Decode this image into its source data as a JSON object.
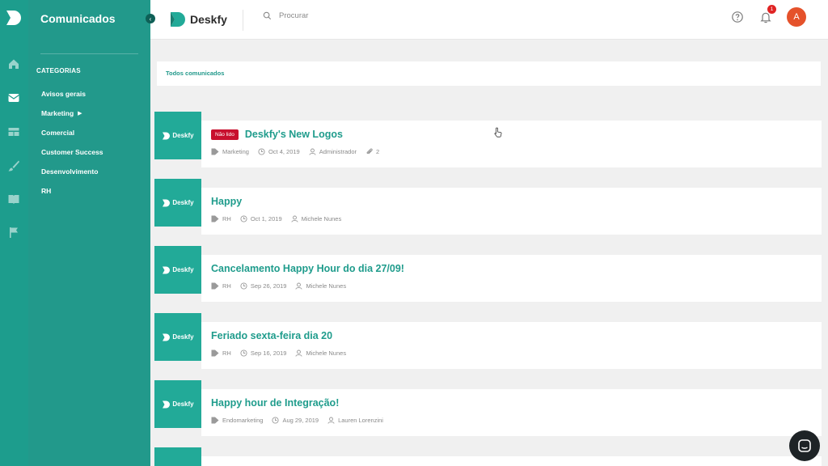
{
  "sidebar": {
    "title": "Comunicados",
    "heading": "CATEGORIAS",
    "items": [
      {
        "label": "Avisos gerais"
      },
      {
        "label": "Marketing",
        "has_submenu": true
      },
      {
        "label": "Comercial"
      },
      {
        "label": "Customer Success"
      },
      {
        "label": "Desenvolvimento"
      },
      {
        "label": "RH"
      }
    ]
  },
  "rail": {
    "icons": [
      "home-icon",
      "mail-icon",
      "layout-icon",
      "brush-icon",
      "book-icon",
      "flag-icon"
    ]
  },
  "header": {
    "brand": "Deskfy",
    "search_placeholder": "Procurar",
    "notification_count": "1",
    "avatar_initial": "A"
  },
  "filter": {
    "label": "Todos comunicados"
  },
  "thumb_label": "Deskfy",
  "announcements": [
    {
      "badge": "Não lido",
      "title": "Deskfy's New Logos",
      "category": "Marketing",
      "date": "Oct 4, 2019",
      "author": "Administrador",
      "attachments": "2"
    },
    {
      "title": "Happy",
      "category": "RH",
      "date": "Oct 1, 2019",
      "author": "Michele Nunes"
    },
    {
      "title": "Cancelamento Happy Hour do dia 27/09!",
      "category": "RH",
      "date": "Sep 26, 2019",
      "author": "Michele Nunes"
    },
    {
      "title": "Feriado sexta-feira dia 20",
      "category": "RH",
      "date": "Sep 16, 2019",
      "author": "Michele Nunes"
    },
    {
      "title": "Happy hour de Integração!",
      "category": "Endomarketing",
      "date": "Aug 29, 2019",
      "author": "Lauren Lorenzini"
    }
  ],
  "colors": {
    "rail": "#1d9d8d",
    "sidebar": "#22998b",
    "accent": "#1f9c8c",
    "thumb": "#22aa98",
    "unread_badge": "#c8102e",
    "avatar": "#e5522b"
  }
}
